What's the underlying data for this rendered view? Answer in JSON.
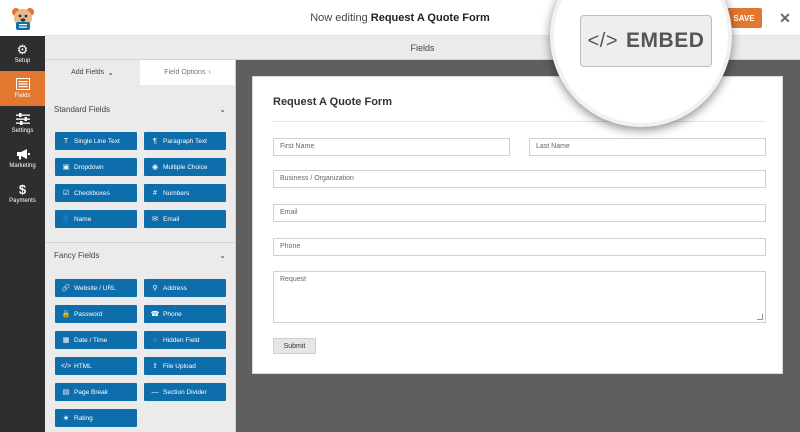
{
  "topbar": {
    "editing_prefix": "Now editing",
    "form_name": "Request A Quote Form",
    "save_label": "SAVE",
    "close_glyph": "✕"
  },
  "leftnav": {
    "items": [
      {
        "label": "Setup",
        "icon": "gear-icon",
        "glyph": "⚙",
        "active": false
      },
      {
        "label": "Fields",
        "icon": "fields-icon",
        "glyph": "",
        "active": true
      },
      {
        "label": "Settings",
        "icon": "sliders-icon",
        "glyph": "",
        "active": false
      },
      {
        "label": "Marketing",
        "icon": "megaphone-icon",
        "glyph": "",
        "active": false
      },
      {
        "label": "Payments",
        "icon": "dollar-icon",
        "glyph": "$",
        "active": false
      }
    ]
  },
  "fields_header": "Fields",
  "panel": {
    "tab_add": "Add Fields",
    "tab_add_glyph": "⌄",
    "tab_options": "Field Options",
    "tab_options_glyph": "›",
    "standard_title": "Standard Fields",
    "fancy_title": "Fancy Fields",
    "collapse_glyph": "⌄",
    "standard": [
      {
        "label": "Single Line Text",
        "glyph": "T"
      },
      {
        "label": "Paragraph Text",
        "glyph": "¶"
      },
      {
        "label": "Dropdown",
        "glyph": "▣"
      },
      {
        "label": "Multiple Choice",
        "glyph": "◉"
      },
      {
        "label": "Checkboxes",
        "glyph": "☑"
      },
      {
        "label": "Numbers",
        "glyph": "#"
      },
      {
        "label": "Name",
        "glyph": "👤"
      },
      {
        "label": "Email",
        "glyph": "✉"
      }
    ],
    "fancy": [
      {
        "label": "Website / URL",
        "glyph": "🔗"
      },
      {
        "label": "Address",
        "glyph": "⚲"
      },
      {
        "label": "Password",
        "glyph": "🔒"
      },
      {
        "label": "Phone",
        "glyph": "☎"
      },
      {
        "label": "Date / Time",
        "glyph": "▦"
      },
      {
        "label": "Hidden Field",
        "glyph": "◌"
      },
      {
        "label": "HTML",
        "glyph": "</>"
      },
      {
        "label": "File Upload",
        "glyph": "⇪"
      },
      {
        "label": "Page Break",
        "glyph": "▤"
      },
      {
        "label": "Section Divider",
        "glyph": "—"
      },
      {
        "label": "Rating",
        "glyph": "★"
      }
    ]
  },
  "form": {
    "title": "Request A Quote Form",
    "first_name": "First Name",
    "last_name": "Last Name",
    "business": "Business / Organization",
    "email": "Email",
    "phone": "Phone",
    "request": "Request",
    "submit": "Submit"
  },
  "embed": {
    "glyph": "</>",
    "label": "EMBED"
  },
  "colors": {
    "accent": "#e27730",
    "field_button": "#0e6dab",
    "nav_bg": "#2e2e2e",
    "canvas_bg": "#5f5f5f"
  }
}
